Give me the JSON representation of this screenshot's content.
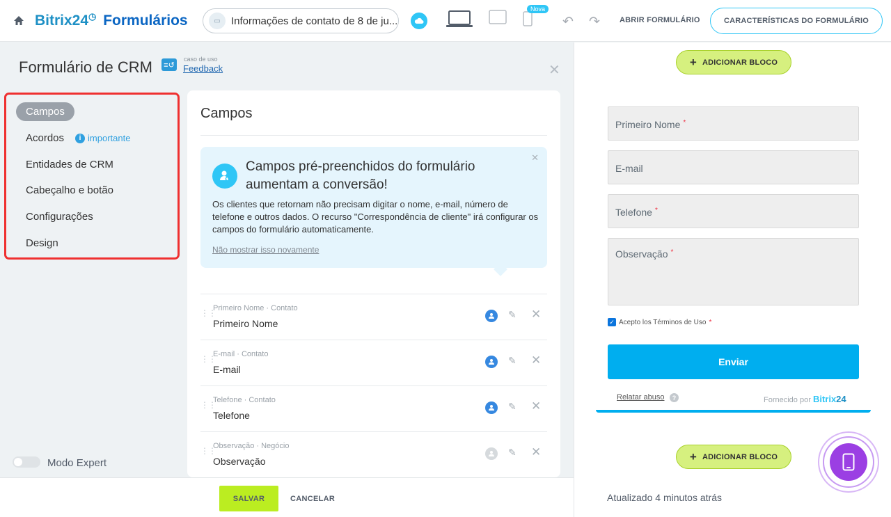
{
  "header": {
    "brand_name": "Bitrix24",
    "clock_glyph": "◷",
    "product": "Formulários",
    "form_selector": "Informações de contato de 8 de ju...",
    "badge_new": "Nova",
    "open_form": "ABRIR FORMULÁRIO",
    "form_characteristics": "CARACTERÍSTICAS DO FORMULÁRIO"
  },
  "page": {
    "title": "Formulário de CRM",
    "use_case_label": "caso de uso",
    "use_case_value": "Feedback"
  },
  "nav": {
    "items": [
      {
        "label": "Campos",
        "active": true
      },
      {
        "label": "Acordos",
        "badge": "importante"
      },
      {
        "label": "Entidades de CRM"
      },
      {
        "label": "Cabeçalho e botão"
      },
      {
        "label": "Configurações"
      },
      {
        "label": "Design"
      }
    ],
    "expert_mode": "Modo Expert"
  },
  "fields_panel": {
    "title": "Campos",
    "promo": {
      "title": "Campos pré-preenchidos do formulário aumentam a conversão!",
      "body": "Os clientes que retornam não precisam digitar o nome, e-mail, número de telefone e outros dados. O recurso \"Correspondência de cliente\" irá configurar os campos do formulário automaticamente.",
      "dismiss": "Não mostrar isso novamente"
    },
    "fields": [
      {
        "meta": "Primeiro Nome · Contato",
        "name": "Primeiro Nome"
      },
      {
        "meta": "E-mail · Contato",
        "name": "E-mail"
      },
      {
        "meta": "Telefone · Contato",
        "name": "Telefone"
      },
      {
        "meta": "Observação · Negócio",
        "name": "Observação"
      }
    ]
  },
  "footer": {
    "save": "SALVAR",
    "cancel": "CANCELAR"
  },
  "preview": {
    "add_block": "ADICIONAR BLOCO",
    "inputs": [
      {
        "label": "Primeiro Nome",
        "required_mark": "*"
      },
      {
        "label": "E-mail"
      },
      {
        "label": "Telefone",
        "required_mark": "*"
      },
      {
        "label": "Observação",
        "required_mark": "*"
      }
    ],
    "terms": "Acepto los Términos de Uso",
    "terms_required": "*",
    "submit": "Enviar",
    "report_abuse": "Relatar abuso",
    "powered_by": "Fornecido por",
    "powered_brand_a": "Bitrix",
    "powered_brand_b": "24",
    "updated": "Atualizado 4 minutos atrás"
  },
  "colors": {
    "accent": "#2fc6f6",
    "save_green": "#bbed21",
    "submit_blue": "#00aeef",
    "highlight_red": "#ef3030"
  }
}
